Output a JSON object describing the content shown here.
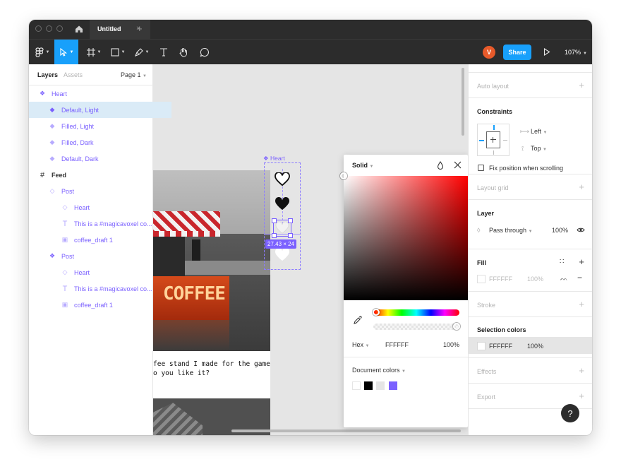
{
  "titlebar": {
    "tab_title": "Untitled",
    "tab_close": "×",
    "tab_add": "+"
  },
  "toolbar": {
    "avatar_initial": "V",
    "share_label": "Share",
    "zoom": "107%"
  },
  "layers_panel": {
    "tab_layers": "Layers",
    "tab_assets": "Assets",
    "page_select": "Page 1",
    "rows": [
      {
        "label": "Heart"
      },
      {
        "label": "Default, Light"
      },
      {
        "label": "Filled, Light"
      },
      {
        "label": "Filled, Dark"
      },
      {
        "label": "Default, Dark"
      },
      {
        "label": "Feed"
      },
      {
        "label": "Post"
      },
      {
        "label": "Heart"
      },
      {
        "label": "This is a #magicavoxel co..."
      },
      {
        "label": "coffee_draft 1"
      },
      {
        "label": "Post"
      },
      {
        "label": "Heart"
      },
      {
        "label": "This is a #magicavoxel co..."
      },
      {
        "label": "coffee_draft 1"
      }
    ]
  },
  "canvas": {
    "heart_label": "Heart",
    "size_badge": "27.43 × 24",
    "sign_text": "COFFEE",
    "post_text": "fee stand I made for the game\no you like it?"
  },
  "color_picker": {
    "mode": "Solid",
    "format": "Hex",
    "hex": "FFFFFF",
    "opacity": "100%",
    "document_colors_label": "Document colors",
    "document_colors": [
      "#ffffff",
      "#000000",
      "#e5e5e5",
      "#7b61ff"
    ]
  },
  "properties": {
    "auto_layout": "Auto layout",
    "constraints": "Constraints",
    "constraint_h": "Left",
    "constraint_v": "Top",
    "fix_position": "Fix position when scrolling",
    "layout_grid": "Layout grid",
    "layer": "Layer",
    "blend_mode": "Pass through",
    "layer_opacity": "100%",
    "fill": "Fill",
    "fill_hex": "FFFFFF",
    "fill_opacity": "100%",
    "stroke": "Stroke",
    "selection_colors": "Selection colors",
    "sel_hex": "FFFFFF",
    "sel_opacity": "100%",
    "effects": "Effects",
    "export": "Export"
  },
  "help": "?"
}
